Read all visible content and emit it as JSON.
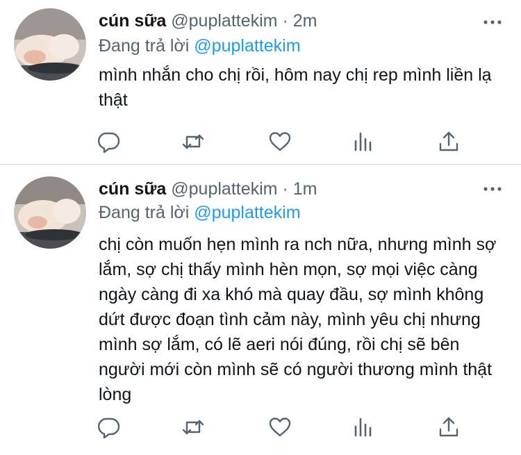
{
  "tweets": [
    {
      "author_name": "cún sữa",
      "author_handle": "@puplattekim",
      "dot": "·",
      "time": "2m",
      "reply_prefix": "Đang trả lời",
      "reply_to": "@puplattekim",
      "text": "mình nhắn cho chị rồi, hôm nay chị rep mình liền lạ thật"
    },
    {
      "author_name": "cún sữa",
      "author_handle": "@puplattekim",
      "dot": "·",
      "time": "1m",
      "reply_prefix": "Đang trả lời",
      "reply_to": "@puplattekim",
      "text": "chị còn muốn hẹn mình ra nch nữa, nhưng mình sợ lắm, sợ chị thấy mình hèn mọn, sợ mọi việc càng ngày càng đi xa khó mà quay đầu, sợ mình không dứt được đoạn tình cảm này, mình yêu chị nhưng mình sợ lắm, có lẽ aeri nói đúng, rồi chị sẽ bên người mới còn mình sẽ có người thương mình thật lòng"
    }
  ],
  "icons": {
    "avatar": "avatar-photo",
    "more": "more-dots-icon",
    "reply": "reply-bubble-icon",
    "retweet": "retweet-icon",
    "like": "heart-icon",
    "stats": "stats-bars-icon",
    "share": "share-icon"
  },
  "colors": {
    "text": "#0f1419",
    "secondary": "#536471",
    "mention": "#1d9bf0",
    "divider": "#d4d9dd"
  }
}
